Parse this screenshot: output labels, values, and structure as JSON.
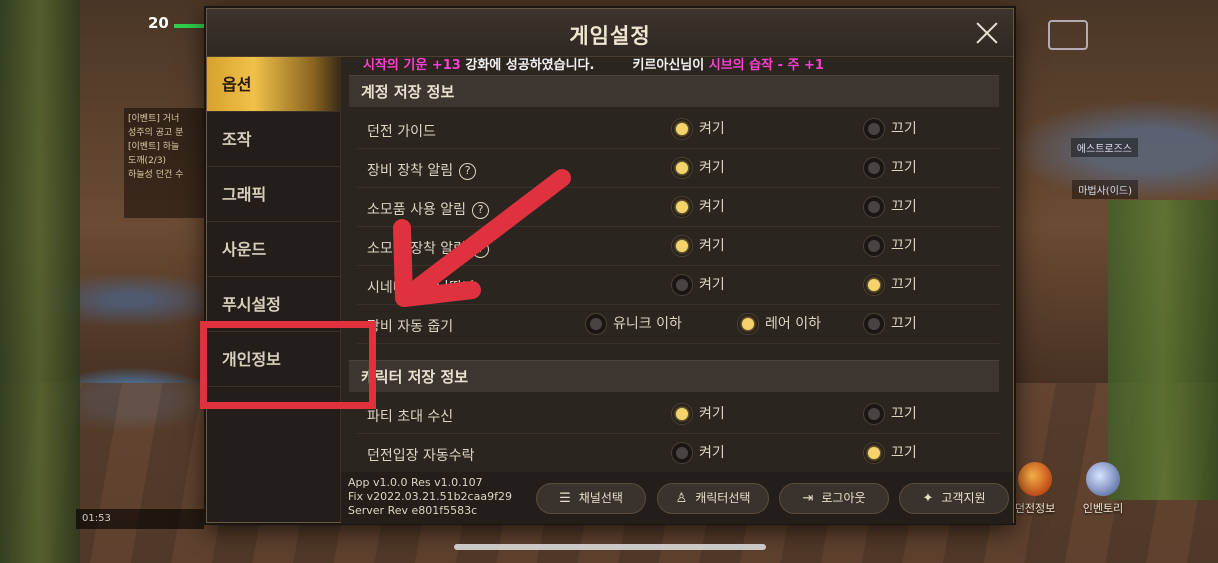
{
  "dialog": {
    "title": "게임설정"
  },
  "sidebar": {
    "items": [
      {
        "label": "옵션",
        "active": true
      },
      {
        "label": "조작"
      },
      {
        "label": "그래픽"
      },
      {
        "label": "사운드"
      },
      {
        "label": "푸시설정"
      },
      {
        "label": "개인정보"
      }
    ]
  },
  "notification": {
    "part1_pink": "시작의 기운 +13",
    "part1_white": " 강화에 성공하였습니다.",
    "part2_white": "키르아신님이 ",
    "part2_pink": "시브의 습작 - 주 +1"
  },
  "sections": {
    "account": "계정 저장 정보",
    "character": "캐릭터 저장 정보"
  },
  "options": {
    "on": "켜기",
    "off": "끄기",
    "unique_below": "유니크 이하",
    "rare_below": "레어 이하"
  },
  "rows": [
    {
      "label": "던전 가이드",
      "value": "on"
    },
    {
      "label": "장비 장착 알림",
      "help": "?",
      "value": "on"
    },
    {
      "label": "소모품 사용 알림",
      "help": "?",
      "value": "on"
    },
    {
      "label": "소모품 장착 알림",
      "help": "?",
      "value": "on"
    },
    {
      "label": "시네마틱 건너뛰기",
      "value": "off"
    },
    {
      "label": "장비 자동 줍기",
      "value": "rare_below"
    },
    {
      "label": "파티 초대 수신",
      "value": "on"
    },
    {
      "label": "던전입장 자동수락",
      "value": "off"
    }
  ],
  "footer": {
    "version_lines": [
      "App v1.0.0 Res v1.0.107",
      "Fix v2022.03.21.51b2caa9f29",
      "Server Rev e801f5583c"
    ],
    "buttons": {
      "channel": "채널선택",
      "character": "캐릭터선택",
      "logout": "로그아웃",
      "support": "고객지원"
    }
  },
  "hud": {
    "level": "20",
    "clock": "01:53",
    "quest_lines": [
      "[이벤트] 거너",
      "성주의 공고 분",
      "[이벤트] 하늘",
      "도깨(2/3)",
      "하늘성 던건 수"
    ],
    "right_labels": [
      "던전정보",
      "인벤토리"
    ],
    "side_labels": [
      "에스트로즈스",
      "마법사(이드)"
    ]
  },
  "colors": {
    "highlight_pink": "#ff3fd0",
    "active_tab": "#f0c14a",
    "radio_on": "#f6d36a",
    "annotation_red": "#e0313f"
  }
}
